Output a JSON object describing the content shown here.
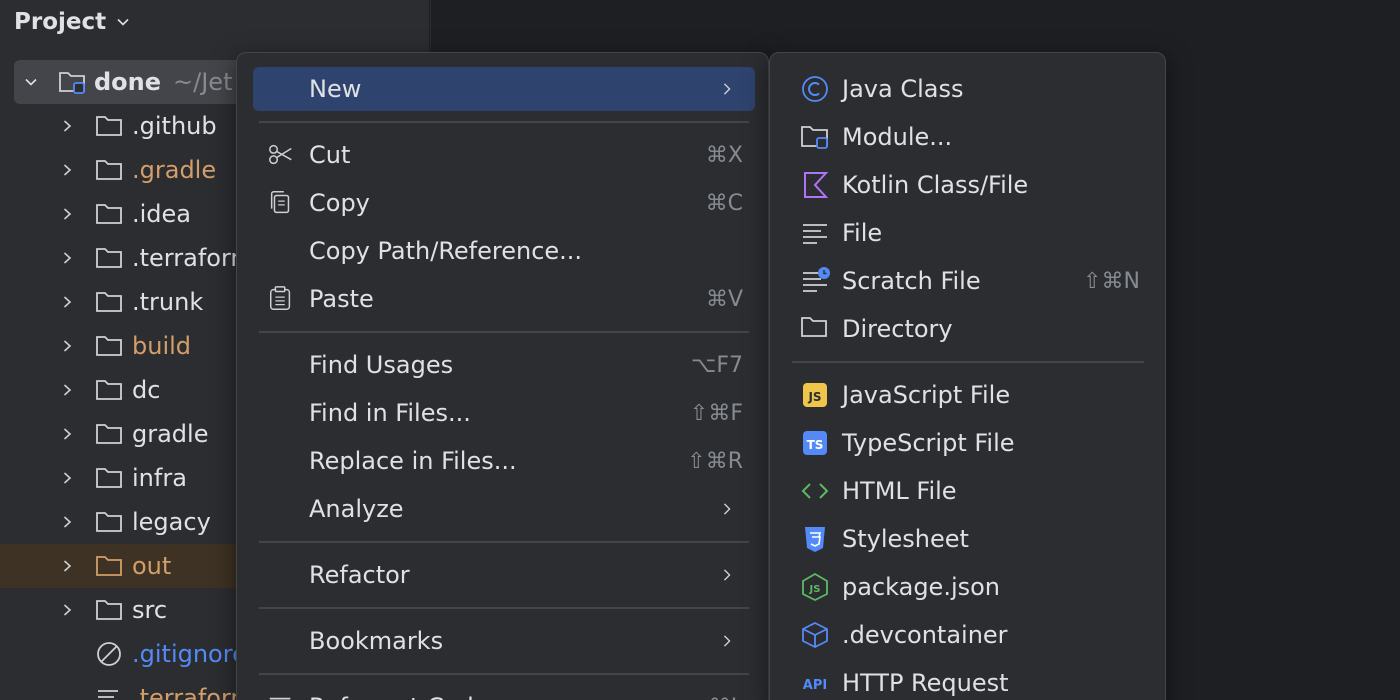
{
  "project_panel": {
    "title": "Project",
    "root": {
      "name": "done",
      "path": "~/Jet"
    },
    "items": [
      {
        "label": ".github",
        "color": "#dfe1e5",
        "icon": "folder-icon"
      },
      {
        "label": ".gradle",
        "color": "#d49e6a",
        "icon": "folder-icon"
      },
      {
        "label": ".idea",
        "color": "#dfe1e5",
        "icon": "folder-icon"
      },
      {
        "label": ".terraform",
        "color": "#dfe1e5",
        "icon": "folder-icon"
      },
      {
        "label": ".trunk",
        "color": "#dfe1e5",
        "icon": "folder-icon"
      },
      {
        "label": "build",
        "color": "#d49e6a",
        "icon": "folder-icon"
      },
      {
        "label": "dc",
        "color": "#dfe1e5",
        "icon": "folder-icon"
      },
      {
        "label": "gradle",
        "color": "#dfe1e5",
        "icon": "folder-icon"
      },
      {
        "label": "infra",
        "color": "#dfe1e5",
        "icon": "folder-icon"
      },
      {
        "label": "legacy",
        "color": "#dfe1e5",
        "icon": "folder-icon"
      },
      {
        "label": "out",
        "color": "#d49e6a",
        "icon": "folder-icon"
      },
      {
        "label": "src",
        "color": "#dfe1e5",
        "icon": "folder-icon"
      },
      {
        "label": ".gitignore",
        "color": "#548af7",
        "icon": "ignored-file-icon"
      },
      {
        "label": ".terraform",
        "color": "#d49e6a",
        "icon": "text-file-icon"
      }
    ]
  },
  "context_menu": {
    "items": [
      {
        "label": "New",
        "shortcut": "",
        "submenu": true,
        "icon": ""
      },
      {
        "label": "Cut",
        "shortcut": "⌘X",
        "submenu": false,
        "icon": "scissors-icon"
      },
      {
        "label": "Copy",
        "shortcut": "⌘C",
        "submenu": false,
        "icon": "copy-icon"
      },
      {
        "label": "Copy Path/Reference...",
        "shortcut": "",
        "submenu": false,
        "icon": ""
      },
      {
        "label": "Paste",
        "shortcut": "⌘V",
        "submenu": false,
        "icon": "paste-icon"
      },
      {
        "label": "Find Usages",
        "shortcut": "⌥F7",
        "submenu": false,
        "icon": ""
      },
      {
        "label": "Find in Files...",
        "shortcut": "⇧⌘F",
        "submenu": false,
        "icon": ""
      },
      {
        "label": "Replace in Files...",
        "shortcut": "⇧⌘R",
        "submenu": false,
        "icon": ""
      },
      {
        "label": "Analyze",
        "shortcut": "",
        "submenu": true,
        "icon": ""
      },
      {
        "label": "Refactor",
        "shortcut": "",
        "submenu": true,
        "icon": ""
      },
      {
        "label": "Bookmarks",
        "shortcut": "",
        "submenu": true,
        "icon": ""
      },
      {
        "label": "Reformat Code",
        "shortcut": "⌥⌘L",
        "submenu": false,
        "icon": "reformat-icon"
      }
    ]
  },
  "new_submenu": {
    "items": [
      {
        "label": "Java Class",
        "shortcut": "",
        "icon": "java-class-icon"
      },
      {
        "label": "Module...",
        "shortcut": "",
        "icon": "module-icon"
      },
      {
        "label": "Kotlin Class/File",
        "shortcut": "",
        "icon": "kotlin-icon"
      },
      {
        "label": "File",
        "shortcut": "",
        "icon": "file-icon"
      },
      {
        "label": "Scratch File",
        "shortcut": "⇧⌘N",
        "icon": "scratch-file-icon"
      },
      {
        "label": "Directory",
        "shortcut": "",
        "icon": "folder-icon"
      },
      {
        "label": "JavaScript File",
        "shortcut": "",
        "icon": "javascript-icon"
      },
      {
        "label": "TypeScript File",
        "shortcut": "",
        "icon": "typescript-icon"
      },
      {
        "label": "HTML File",
        "shortcut": "",
        "icon": "html-icon"
      },
      {
        "label": "Stylesheet",
        "shortcut": "",
        "icon": "css-icon"
      },
      {
        "label": "package.json",
        "shortcut": "",
        "icon": "nodejs-icon"
      },
      {
        "label": ".devcontainer",
        "shortcut": "",
        "icon": "devcontainer-icon"
      },
      {
        "label": "HTTP Request",
        "shortcut": "",
        "icon": "http-request-icon"
      }
    ]
  },
  "colors": {
    "selection": "#2e436e",
    "excluded": "#d49e6a",
    "ignored": "#548af7",
    "accent": "#548af7"
  }
}
